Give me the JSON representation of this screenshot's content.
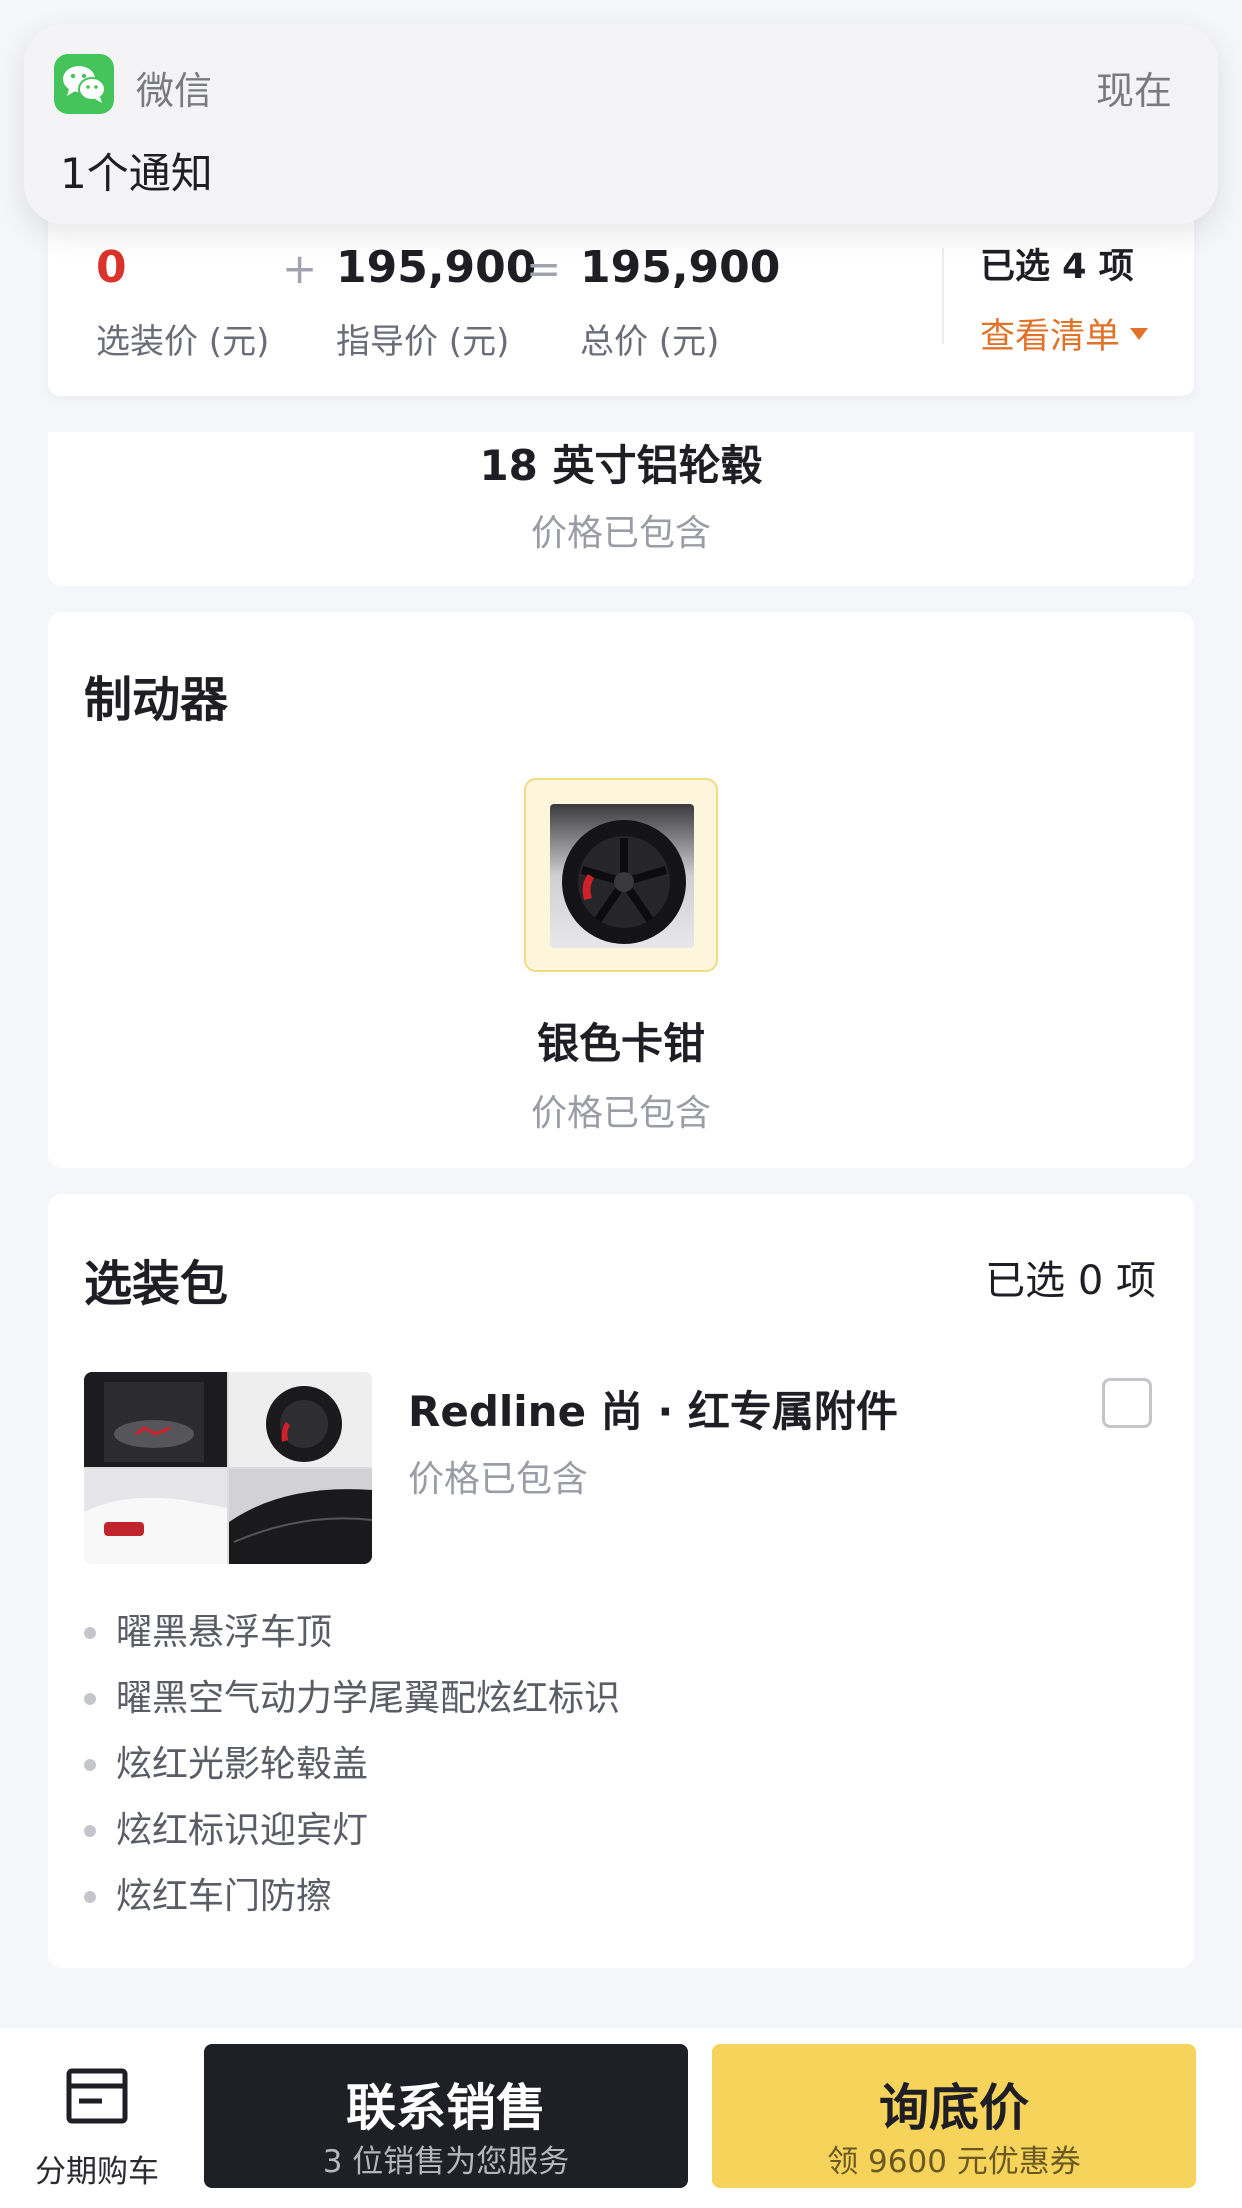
{
  "notification": {
    "app_name": "微信",
    "time": "现在",
    "message": "1个通知",
    "icon": "wechat-icon"
  },
  "price_summary": {
    "option_price": "0",
    "option_price_label": "选装价 (元)",
    "plus": "+",
    "guide_price": "195,900",
    "guide_price_label": "指导价 (元)",
    "equals": "=",
    "total_price": "195,900",
    "total_price_label": "总价 (元)",
    "selected_count": "已选 4 项",
    "view_list": "查看清单",
    "accent_color": "#e0732a",
    "option_price_color": "#d9342b"
  },
  "wheel_card": {
    "item_name": "18 英寸铝轮毂",
    "item_price": "价格已包含"
  },
  "brake_card": {
    "title": "制动器",
    "item_name": "银色卡钳",
    "item_price": "价格已包含"
  },
  "package_card": {
    "title": "选装包",
    "selected_count": "已选 0 项",
    "package_name": "Redline 尚 · 红专属附件",
    "package_price": "价格已包含",
    "checked": false,
    "features": [
      "曜黑悬浮车顶",
      "曜黑空气动力学尾翼配炫红标识",
      "炫红光影轮毂盖",
      "炫红标识迎宾灯",
      "炫红车门防擦"
    ]
  },
  "bottom_bar": {
    "installment_label": "分期购车",
    "installment_icon": "installment-icon",
    "contact_sales": "联系销售",
    "contact_sales_sub": "3 位销售为您服务",
    "inquiry": "询底价",
    "inquiry_sub": "领 9600 元优惠券",
    "dark_color": "#1e2026",
    "yellow_color": "#f6d35a"
  }
}
